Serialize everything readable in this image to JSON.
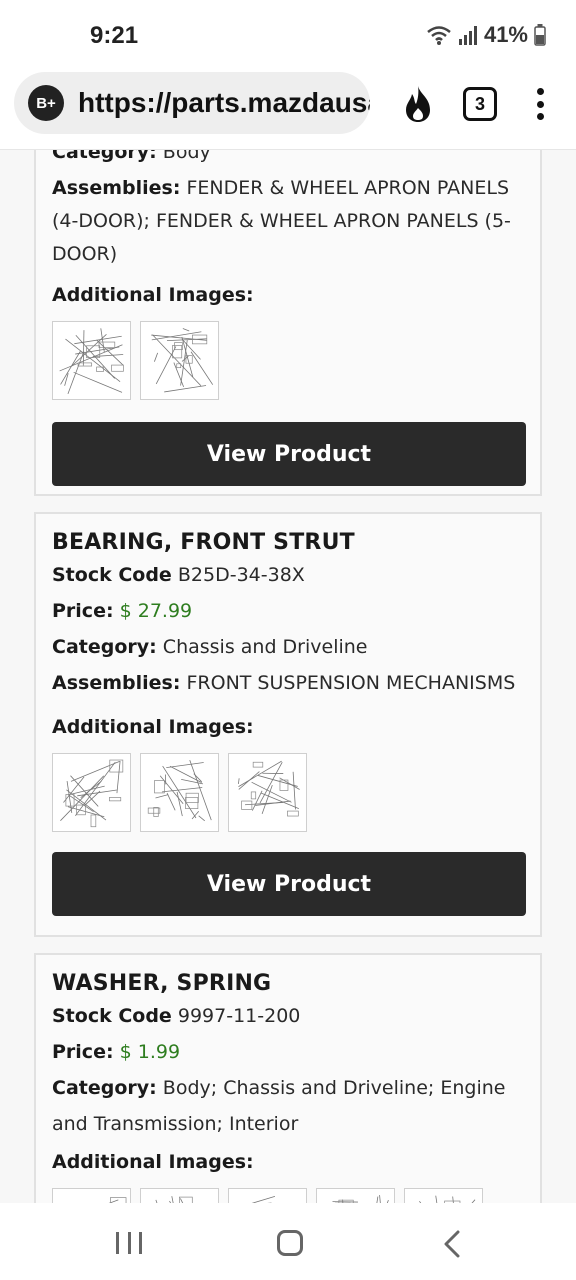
{
  "status": {
    "time": "9:21",
    "battery": "41%"
  },
  "browser": {
    "badge": "B+",
    "url": "https://parts.mazdausa",
    "tab_count": "3"
  },
  "products": [
    {
      "name": "",
      "category_label": "Category:",
      "category": "Body",
      "assemblies_label": "Assemblies:",
      "assemblies": "FENDER & WHEEL APRON PANELS (4-DOOR); FENDER & WHEEL APRON PANELS (5-DOOR)",
      "images_label": "Additional Images:",
      "image_count": 2,
      "button": "View Product"
    },
    {
      "name": "BEARING, FRONT STRUT",
      "stock_label": "Stock Code",
      "stock_code": "B25D-34-38X",
      "price_label": "Price:",
      "price": "$ 27.99",
      "category_label": "Category:",
      "category": "Chassis and Driveline",
      "assemblies_label": "Assemblies:",
      "assemblies": "FRONT SUSPENSION MECHANISMS",
      "images_label": "Additional Images:",
      "image_count": 3,
      "button": "View Product"
    },
    {
      "name": "WASHER, SPRING",
      "stock_label": "Stock Code",
      "stock_code": "9997-11-200",
      "price_label": "Price:",
      "price": "$ 1.99",
      "category_label": "Category:",
      "category": "Body; Chassis and Driveline; Engine and Transmission; Interior",
      "images_label": "Additional Images:",
      "image_count": 5
    }
  ],
  "colors": {
    "price_green": "#2e7d1f",
    "button_bg": "#2a2a2a"
  },
  "icons": [
    "wifi-icon",
    "signal-icon",
    "battery-icon",
    "fire-icon",
    "tabs-icon",
    "menu-icon",
    "recents-icon",
    "home-icon",
    "back-icon"
  ]
}
